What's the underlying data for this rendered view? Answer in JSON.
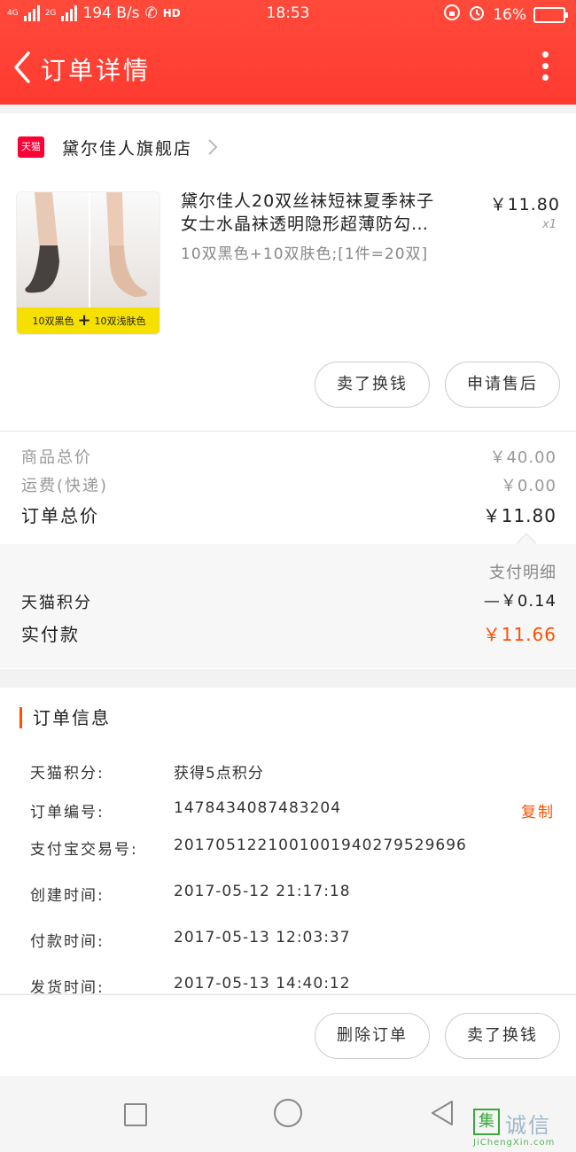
{
  "status_bar": {
    "network_label_1": "4G",
    "network_label_2": "2G",
    "speed": "194 B/s",
    "hd": "HD",
    "time": "18:53",
    "battery": "16%",
    "battery_level": 0.16
  },
  "header": {
    "title": "订单详情"
  },
  "shop": {
    "badge": "天猫",
    "name": "黛尔佳人旗舰店"
  },
  "product": {
    "title_line1": "黛尔佳人20双丝袜短袜夏季袜子",
    "title_line2": "女士水晶袜透明隐形超薄防勾…",
    "price": "￥11.80",
    "qty": "x1",
    "sku": "10双黑色+10双肤色;[1件=20双]",
    "image_left_label": "10双黑色",
    "image_plus": "+",
    "image_right_label": "10双浅肤色"
  },
  "item_actions": {
    "sell_for_cash": "卖了换钱",
    "apply_after_sale": "申请售后"
  },
  "summary": {
    "goods_total_label": "商品总价",
    "goods_total_value": "￥40.00",
    "shipping_label": "运费(快递)",
    "shipping_value": "￥0.00",
    "order_total_label": "订单总价",
    "order_total_value": "￥11.80"
  },
  "payment": {
    "detail_link": "支付明细",
    "points_label": "天猫积分",
    "points_value": "—￥0.14",
    "paid_label": "实付款",
    "paid_value": "￥11.66"
  },
  "order_info": {
    "title": "订单信息",
    "rows": [
      {
        "label": "天猫积分:",
        "value": "获得5点积分"
      },
      {
        "label": "订单编号:",
        "value": "1478434087483204"
      },
      {
        "label": "支付宝交易号:",
        "value": "2017051221001001940279529696"
      },
      {
        "label": "创建时间:",
        "value": "2017-05-12 21:17:18"
      },
      {
        "label": "付款时间:",
        "value": "2017-05-13 12:03:37"
      },
      {
        "label": "发货时间:",
        "value": "2017-05-13 14:40:12"
      }
    ],
    "copy_label": "复制"
  },
  "bottom_actions": {
    "delete_order": "删除订单",
    "sell_for_cash": "卖了换钱"
  },
  "watermark": {
    "box": "集",
    "text": "诚信",
    "url": "JiChengXin.com"
  },
  "colors": {
    "header_red": "#ff3a30",
    "accent_orange": "#ff5000",
    "tmall_red": "#ff0036"
  }
}
